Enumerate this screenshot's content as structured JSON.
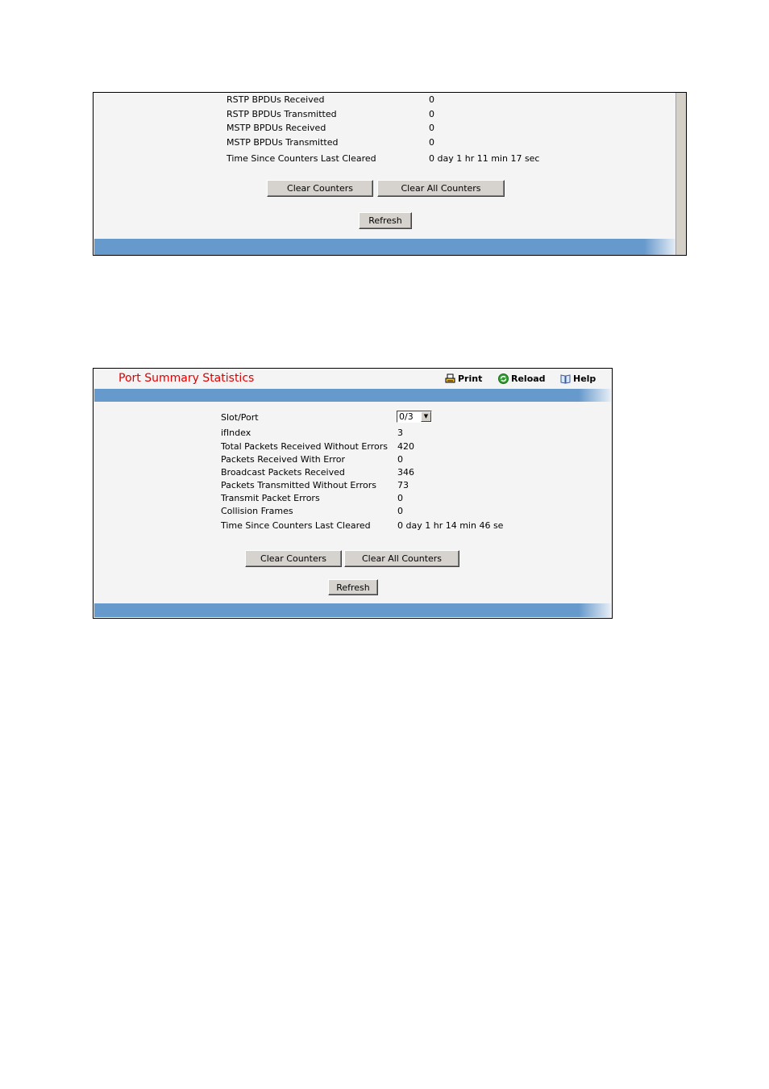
{
  "stp_panel": {
    "rows": [
      {
        "label": "RSTP BPDUs Received",
        "value": "0"
      },
      {
        "label": "RSTP BPDUs Transmitted",
        "value": "0"
      },
      {
        "label": "MSTP BPDUs Received",
        "value": "0"
      },
      {
        "label": "MSTP BPDUs Transmitted",
        "value": "0"
      },
      {
        "label": "Time Since Counters Last Cleared",
        "value": "0 day 1 hr 11 min 17 sec"
      }
    ],
    "buttons": {
      "clear_counters": "Clear Counters",
      "clear_all_counters": "Clear All Counters",
      "refresh": "Refresh"
    }
  },
  "port_panel": {
    "title": "Port Summary Statistics",
    "toolbar": {
      "print": "Print",
      "reload": "Reload",
      "help": "Help"
    },
    "slot_port": {
      "label": "Slot/Port",
      "selected": "0/3"
    },
    "rows": [
      {
        "label": "ifIndex",
        "value": "3"
      },
      {
        "label": "Total Packets Received Without Errors",
        "value": "420"
      },
      {
        "label": "Packets Received With Error",
        "value": "0"
      },
      {
        "label": "Broadcast Packets Received",
        "value": "346"
      },
      {
        "label": "Packets Transmitted Without Errors",
        "value": "73"
      },
      {
        "label": "Transmit Packet Errors",
        "value": "0"
      },
      {
        "label": "Collision Frames",
        "value": "0"
      },
      {
        "label": "Time Since Counters Last Cleared",
        "value": "0 day 1 hr 14 min 46 se"
      }
    ],
    "buttons": {
      "clear_counters": "Clear Counters",
      "clear_all_counters": "Clear All Counters",
      "refresh": "Refresh"
    }
  },
  "colors": {
    "title_red": "#e00000",
    "bar_blue": "#6699cc",
    "panel_bg": "#f4f4f4"
  }
}
